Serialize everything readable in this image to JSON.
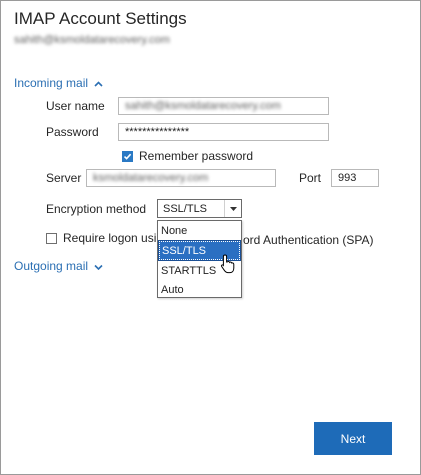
{
  "dialog": {
    "title": "IMAP Account Settings",
    "account_email": "sahith@ksmoldatarecovery.com"
  },
  "incoming": {
    "section_label": "Incoming mail",
    "username_label": "User name",
    "username_value": "sahith@ksmoldatarecovery.com",
    "password_label": "Password",
    "password_value": "***************",
    "remember_label": "Remember password",
    "remember_checked": true,
    "server_label": "Server",
    "server_value": "ksmoldatarecovery.com",
    "port_label": "Port",
    "port_value": "993",
    "encryption_label": "Encryption method",
    "encryption_selected": "SSL/TLS",
    "encryption_options": [
      "None",
      "SSL/TLS",
      "STARTTLS",
      "Auto"
    ],
    "spa_label_left": "Require logon usi",
    "spa_label_right": "ord Authentication (SPA)",
    "spa_checked": false
  },
  "outgoing": {
    "section_label": "Outgoing mail"
  },
  "footer": {
    "next_label": "Next"
  },
  "colors": {
    "accent": "#1e6bb8",
    "link": "#2b6fb3",
    "selection": "#2a6fc2"
  }
}
